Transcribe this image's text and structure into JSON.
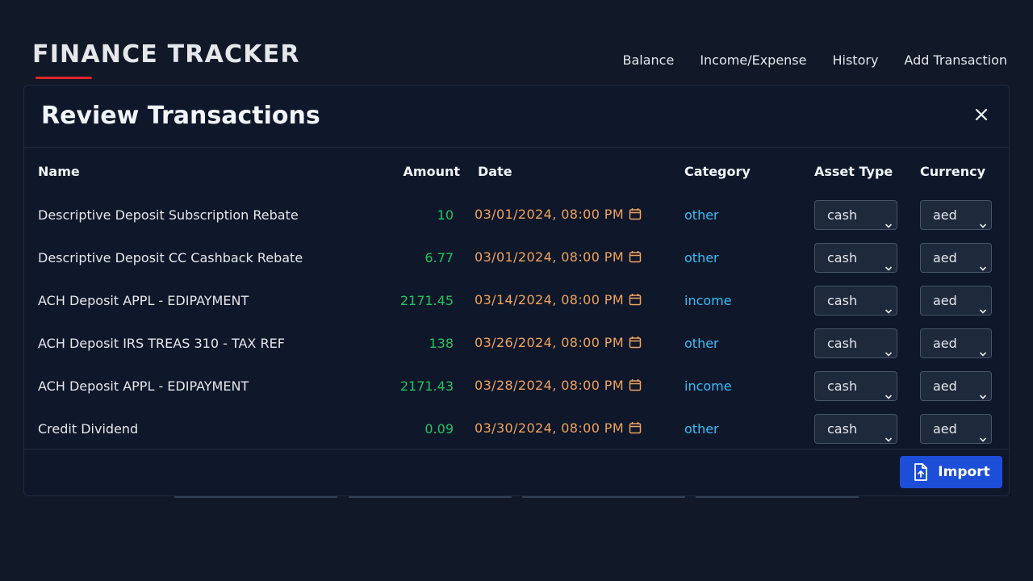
{
  "app": {
    "title": "FINANCE TRACKER"
  },
  "nav": [
    {
      "label": "Balance"
    },
    {
      "label": "Income/Expense"
    },
    {
      "label": "History"
    },
    {
      "label": "Add Transaction"
    }
  ],
  "modal": {
    "title": "Review Transactions",
    "columns": {
      "name": "Name",
      "amount": "Amount",
      "date": "Date",
      "category": "Category",
      "asset_type": "Asset Type",
      "currency": "Currency"
    },
    "rows": [
      {
        "name": "Descriptive Deposit Subscription Rebate",
        "amount": "10",
        "date": "03/01/2024, 08:00 PM",
        "category": "other",
        "asset_type": "cash",
        "currency": "aed"
      },
      {
        "name": "Descriptive Deposit CC Cashback Rebate",
        "amount": "6.77",
        "date": "03/01/2024, 08:00 PM",
        "category": "other",
        "asset_type": "cash",
        "currency": "aed"
      },
      {
        "name": "ACH Deposit APPL - EDIPAYMENT",
        "amount": "2171.45",
        "date": "03/14/2024, 08:00 PM",
        "category": "income",
        "asset_type": "cash",
        "currency": "aed"
      },
      {
        "name": "ACH Deposit IRS TREAS 310 - TAX REF",
        "amount": "138",
        "date": "03/26/2024, 08:00 PM",
        "category": "other",
        "asset_type": "cash",
        "currency": "aed"
      },
      {
        "name": "ACH Deposit APPL - EDIPAYMENT",
        "amount": "2171.43",
        "date": "03/28/2024, 08:00 PM",
        "category": "income",
        "asset_type": "cash",
        "currency": "aed"
      },
      {
        "name": "Credit Dividend",
        "amount": "0.09",
        "date": "03/30/2024, 08:00 PM",
        "category": "other",
        "asset_type": "cash",
        "currency": "aed"
      }
    ],
    "import_label": "Import"
  },
  "icons": {
    "close": "close-icon",
    "calendar": "calendar-icon",
    "chevron": "chevron-down-icon",
    "upload": "file-upload-icon"
  },
  "colors": {
    "background": "#111827",
    "modal": "#0f172a",
    "accent_red": "#dc2626",
    "amount_green": "#22c55e",
    "date_orange": "#f0a35e",
    "category_blue": "#38bdf8",
    "primary_button": "#1d4ed8"
  }
}
